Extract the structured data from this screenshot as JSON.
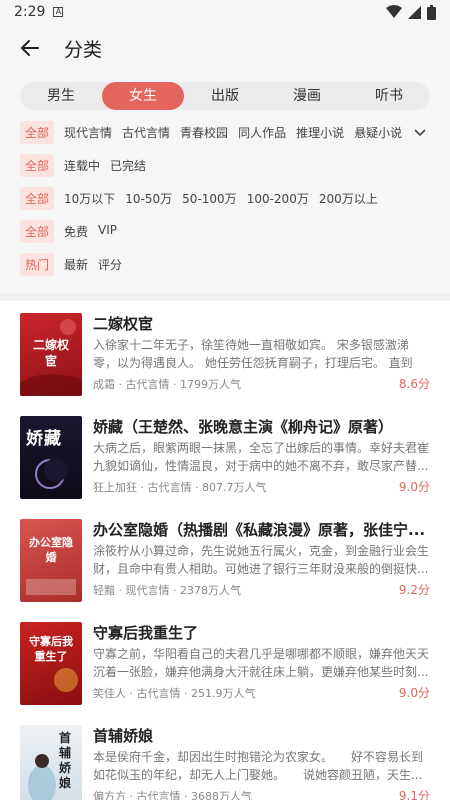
{
  "status_bar": {
    "time": "2:29"
  },
  "header": {
    "title": "分类"
  },
  "gender_tabs": [
    {
      "label": "男生",
      "active": false
    },
    {
      "label": "女生",
      "active": true
    },
    {
      "label": "出版",
      "active": false
    },
    {
      "label": "漫画",
      "active": false
    },
    {
      "label": "听书",
      "active": false
    }
  ],
  "filters": [
    {
      "lead": "全部",
      "options": [
        "现代言情",
        "古代言情",
        "青春校园",
        "同人作品",
        "推理小说",
        "悬疑小说"
      ],
      "expandable": true
    },
    {
      "lead": "全部",
      "options": [
        "连载中",
        "已完结"
      ]
    },
    {
      "lead": "全部",
      "options": [
        "10万以下",
        "10-50万",
        "50-100万",
        "100-200万",
        "200万以上"
      ]
    },
    {
      "lead": "全部",
      "options": [
        "免费",
        "VIP"
      ]
    },
    {
      "lead": "热门",
      "options": [
        "最新",
        "评分"
      ]
    }
  ],
  "books": [
    {
      "title": "二嫁权宦",
      "desc": "入徐家十二年无子，徐笙待她一直相敬如宾。 宋多银感激涕零，以为得遇良人。 她任劳任怨抚育嗣子，打理后宅。 直到镇...",
      "author": "成霜",
      "category": "古代言情",
      "popularity": "1799万人气",
      "score": "8.6分",
      "cover_text": "二嫁权宦"
    },
    {
      "title": "娇藏（王楚然、张晚意主演《柳舟记》原著）",
      "desc": "大病之后，眼紫两眼一抹黑，全忘了出嫁后的事情。幸好夫君崔九貌如谪仙，性情温良，对于病中的她不离不弃，敢尽家产替...",
      "author": "狂上加狂",
      "category": "古代言情",
      "popularity": "807.7万人气",
      "score": "9.0分",
      "cover_text": "娇藏"
    },
    {
      "title": "办公室隐婚（热播剧《私藏浪漫》原著，张佳宁...",
      "desc": "涂筱柠从小算过命，先生说她五行属火，克金，到金融行业会生财，且命中有贵人相助。可她进了银行三年财没来般的倒挺快...",
      "author": "轻黯",
      "category": "现代言情",
      "popularity": "2378万人气",
      "score": "9.2分",
      "cover_text": "办公室隐婚"
    },
    {
      "title": "守寡后我重生了",
      "desc": "守寡之前，华阳看自己的夫君几乎是哪哪都不顺眼，嫌弃他天天沉着一张脸，嫌弃他满身大汗就往床上躺，更嫌弃他某些时刻...",
      "author": "笑佳人",
      "category": "古代言情",
      "popularity": "251.9万人气",
      "score": "9.0分",
      "cover_text": "守寡后我重生了"
    },
    {
      "title": "首辅娇娘",
      "desc": "本是侯府千金，却因出生时抱错沦为农家女。　　好不容易长到如花似玉的年纪，却无人上门娶她。　　说她容颜丑陋，天生...",
      "author": "偏方方",
      "category": "古代言情",
      "popularity": "3688万人气",
      "score": "9.1分",
      "cover_text": "首辅娇娘"
    }
  ],
  "meta_separator": " · ",
  "colors": {
    "accent": "#e3655b",
    "chip_bg": "#fbe3df"
  }
}
